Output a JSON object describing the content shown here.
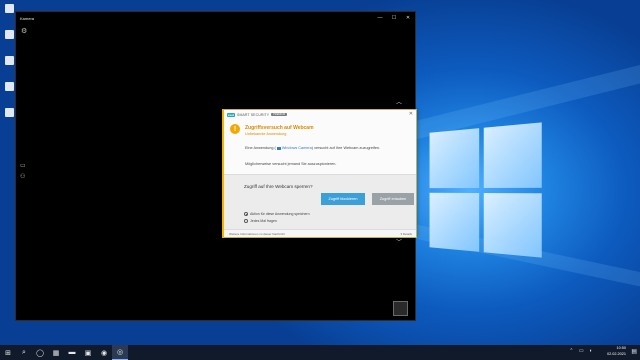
{
  "camera_window": {
    "title": "Kamera",
    "minimize": "—",
    "maximize": "☐",
    "close": "✕",
    "settings_icon": "⚙",
    "side_icons": [
      "▭",
      "⚇"
    ],
    "up_icon": "︿",
    "down_icon": "﹀"
  },
  "eset_dialog": {
    "badge": "eset",
    "product": "SMART SECURITY",
    "edition": "PREMIUM",
    "close": "✕",
    "warning_glyph": "!",
    "title": "Zugriffsversuch auf Webcam",
    "subtitle": "Unbekannte Anwendung",
    "message_prefix": "Eine Anwendung (",
    "app_name": "Windows Camera",
    "message_suffix": ") versucht auf Ihre Webcam zuzugreifen.",
    "message2": "Möglicherweise versucht jemand Sie auszuspionieren.",
    "question": "Zugriff auf Ihre Webcam sperren?",
    "block_button": "Zugriff blockieren",
    "allow_button": "Zugriff erlauben",
    "radio_remember": "Aktion für diese Anwendung speichern",
    "radio_ask": "Jedes Mal fragen",
    "more_info": "Weitere Informationen zu dieser Nachricht",
    "details": "Details"
  },
  "taskbar": {
    "start_icon": "⊞",
    "search_icon": "⌕",
    "taskview_icon": "◯",
    "items": [
      "▦",
      "▬",
      "▣",
      "◉",
      "◎"
    ],
    "tray_icons": "⌃ ▭ ◖",
    "time": "10:50",
    "date": "02.02.2021",
    "notification_icon": "▤"
  }
}
